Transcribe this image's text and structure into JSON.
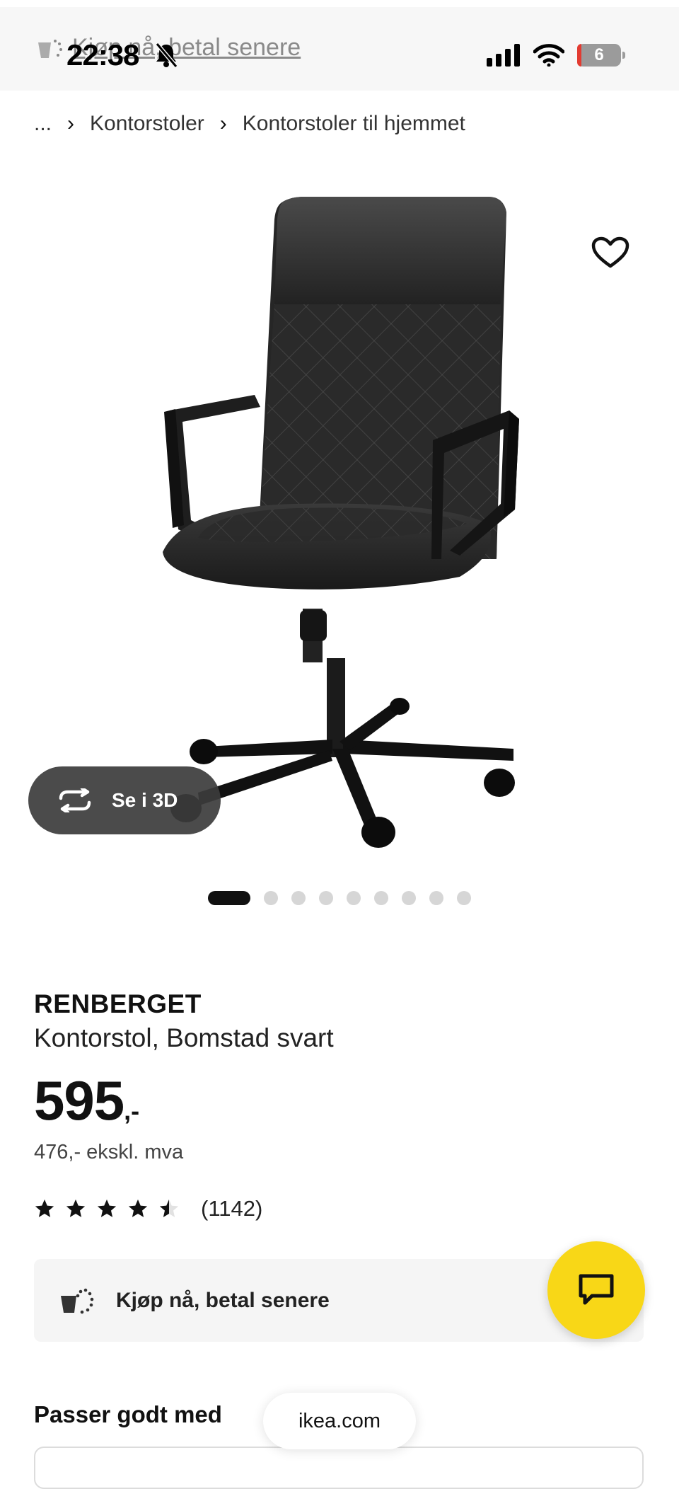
{
  "status_bar": {
    "ghost_banner": "Kjøp nå, betal senere",
    "time": "22:38",
    "battery": "6"
  },
  "breadcrumb": {
    "ellipsis": "...",
    "items": [
      "Kontorstoler",
      "Kontorstoler til hjemmet"
    ]
  },
  "hero": {
    "view_3d_label": "Se i 3D",
    "image_count": 9,
    "active_index": 1
  },
  "product": {
    "name": "RENBERGET",
    "description": "Kontorstol, Bomstad svart",
    "price": "595",
    "price_suffix": ",-",
    "price_ex_vat": "476,- ekskl. mva",
    "rating": 4.5,
    "review_count": "(1142)"
  },
  "klarna": {
    "label": "Kjøp nå, betal senere"
  },
  "section": {
    "passer_title": "Passer godt med"
  },
  "browser": {
    "url": "ikea.com"
  },
  "colors": {
    "chat_yellow": "#f8d717",
    "pill_dark": "#3c3c3c"
  }
}
